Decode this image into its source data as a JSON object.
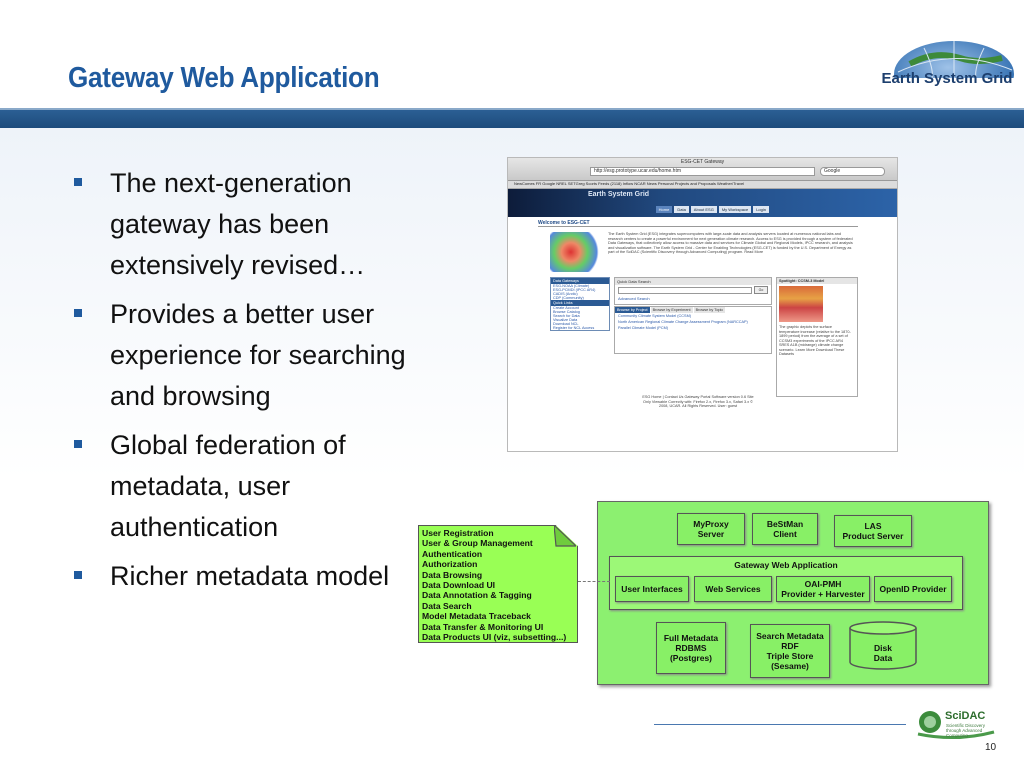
{
  "slide": {
    "title": "Gateway Web Application",
    "logo_text": "Earth System Grid",
    "page_number": "10",
    "footer_logo": {
      "name": "SciDAC",
      "tagline": "Scientific Discovery through Advanced Computing"
    },
    "colors": {
      "title": "#1f5a9e",
      "bar": "#1d4b7c",
      "green_box": "#88f066"
    }
  },
  "bullets": [
    "The next-generation gateway has been extensively revised…",
    "Provides a better user experience for searching and browsing",
    "Global federation of metadata, user authentication",
    "Richer metadata model"
  ],
  "screenshot": {
    "window_title": "ESG-CET Gateway",
    "url": "http://esg.prototype.ucar.edu/home.htm",
    "search_placeholder": "Google",
    "bookmarks": "NewComes  FR  Google  NREL  SETGreg  Scorts  Feeds (2118)  Inflow  NCAR  News  Personal  Projects and Proposals  Weather/Travel",
    "banner": "Earth System Grid",
    "nav": [
      "Home",
      "Data",
      "About ESG",
      "My Workspace",
      "Login"
    ],
    "welcome": "Welcome to ESG-CET",
    "map_title": "The Earth System Grid",
    "intro": "The Earth System Grid (ESG) integrates supercomputers with large-scale data and analysis servers located at numerous national labs and research centers to create a powerful environment for next generation climate research. Access to ESG is provided through a system of federated Data Gateways, that collectively allow access to massive data and services for Climate Global and Regional Models, IPCC research, and analysis and visualization software. The Earth System Grid - Center for Enabling Technologies (ESG-CET) is funded by the U.S. Department of Energy as part of the SciDAC (Scientific Discovery through Advanced Computing) program. Read More",
    "gateways_header": "Data Gateways",
    "gateways": [
      "ESG-NOAA (Climate)",
      "ESG-PCMDI (IPCC AR4)",
      "CADIS (Arctic)",
      "CDP (Community)"
    ],
    "quicklinks_header": "Quick Links",
    "quicklinks": [
      "Create Account",
      "Browse Catalog",
      "Search for Data",
      "Visualize Data",
      "Download NCL",
      "Register for NCL Access"
    ],
    "quick_search_header": "Quick Data Search",
    "go": "Go",
    "advanced": "Advanced Search",
    "tabs": [
      "Browse by Project",
      "Browse by Experiment",
      "Browse by Topic"
    ],
    "projects": [
      "Community Climate System Model (CCSM)",
      "North American Regional Climate Change Assessment Program (NARCCAP)",
      "Parallel Climate Model (PCM)"
    ],
    "spotlight_header": "Spotlight: CCSM-3 Model",
    "spotlight_text": "The graphic depicts the surface temperature increase (relative to the 1870-1899 period) from the average of a set of CCSM3 experiments of the IPCC AR4 SRES A1B (midrange) climate change scenario. Learn More Download These Datasets",
    "footer": "ESG Home | Contact Us Gateway Portal Software version 0.6 Site Only Viewable Correctly with: Firefox 2.x, Firefox 3.x, Safari 3.x © 2008, UCAR. All Rights Reserved. User: guest"
  },
  "diagram": {
    "note_items": [
      "User Registration",
      "User & Group Management",
      "Authentication",
      "Authorization",
      "Data Browsing",
      "Data Download UI",
      "Data Annotation & Tagging",
      "Data Search",
      "Model Metadata Traceback",
      "Data Transfer & Monitoring UI",
      "Data Products UI (viz, subsetting...)"
    ],
    "myproxy": "MyProxy\nServer",
    "bestman": "BeStMan\nClient",
    "las": "LAS\nProduct Server",
    "gateway_app": "Gateway Web Application",
    "user_interfaces": "User Interfaces",
    "web_services": "Web Services",
    "oai_pmh": "OAI-PMH\nProvider + Harvester",
    "openid": "OpenID Provider",
    "full_metadata": "Full Metadata\nRDBMS\n(Postgres)",
    "search_metadata": "Search Metadata\nRDF\nTriple Store\n(Sesame)",
    "disk": "Disk\nData"
  }
}
